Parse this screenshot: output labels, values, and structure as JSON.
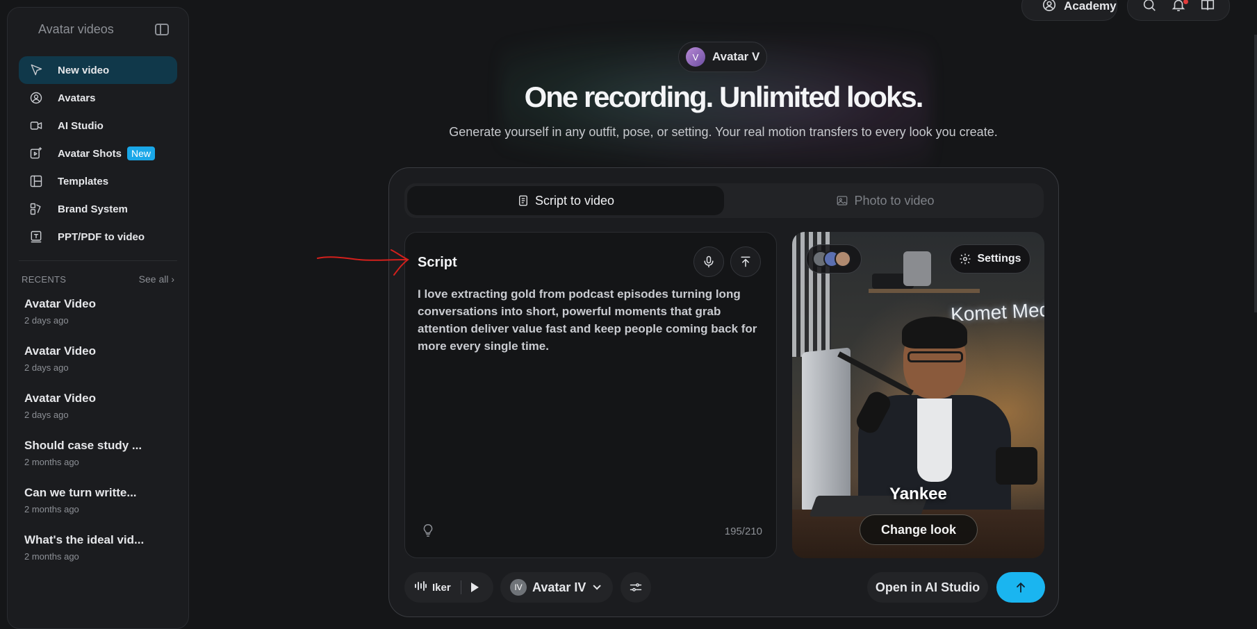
{
  "sidebar": {
    "title": "Avatar videos",
    "items": [
      {
        "label": "New video",
        "icon": "cursor-icon",
        "active": true
      },
      {
        "label": "Avatars",
        "icon": "user-circle-icon"
      },
      {
        "label": "AI Studio",
        "icon": "video-camera-icon"
      },
      {
        "label": "Avatar Shots",
        "icon": "video-sparkle-icon",
        "badge": "New"
      },
      {
        "label": "Templates",
        "icon": "layout-icon"
      },
      {
        "label": "Brand System",
        "icon": "palette-icon"
      },
      {
        "label": "PPT/PDF to video",
        "icon": "document-icon"
      }
    ],
    "recents_title": "RECENTS",
    "see_all": "See all ›",
    "recents": [
      {
        "title": "Avatar Video",
        "time": "2 days ago"
      },
      {
        "title": "Avatar Video",
        "time": "2 days ago"
      },
      {
        "title": "Avatar Video",
        "time": "2 days ago"
      },
      {
        "title": "Should case study ...",
        "time": "2 months ago"
      },
      {
        "title": "Can we turn writte...",
        "time": "2 months ago"
      },
      {
        "title": "What's the ideal vid...",
        "time": "2 months ago"
      }
    ]
  },
  "topbar": {
    "academy": "Academy",
    "icons": [
      "search-icon",
      "bell-icon",
      "book-icon"
    ]
  },
  "hero": {
    "chip_initial": "V",
    "chip_label": "Avatar V",
    "headline": "One recording. Unlimited looks.",
    "subline": "Generate yourself in any outfit, pose, or setting. Your real motion transfers to every look you create."
  },
  "tabs": [
    {
      "label": "Script to video",
      "active": true
    },
    {
      "label": "Photo to video",
      "active": false
    }
  ],
  "script": {
    "label": "Script",
    "text": "I love extracting gold from podcast episodes turning long conversations into short, powerful moments that grab attention deliver value fast and keep people coming back for more every single time.",
    "char_count": "195/210"
  },
  "preview": {
    "settings_label": "Settings",
    "sign_text": "Komet Med",
    "avatar_name": "Yankee",
    "change_look": "Change look",
    "avatar_colors": [
      "#6b6f75",
      "#5b6fb0",
      "#b08a70"
    ]
  },
  "bottom": {
    "voice": "Iker",
    "model_badge": "IV",
    "model": "Avatar IV",
    "open_studio": "Open in AI Studio"
  },
  "colors": {
    "accent": "#1ab5f0",
    "active_nav": "#10384a",
    "badge": "#1aa7e8"
  }
}
